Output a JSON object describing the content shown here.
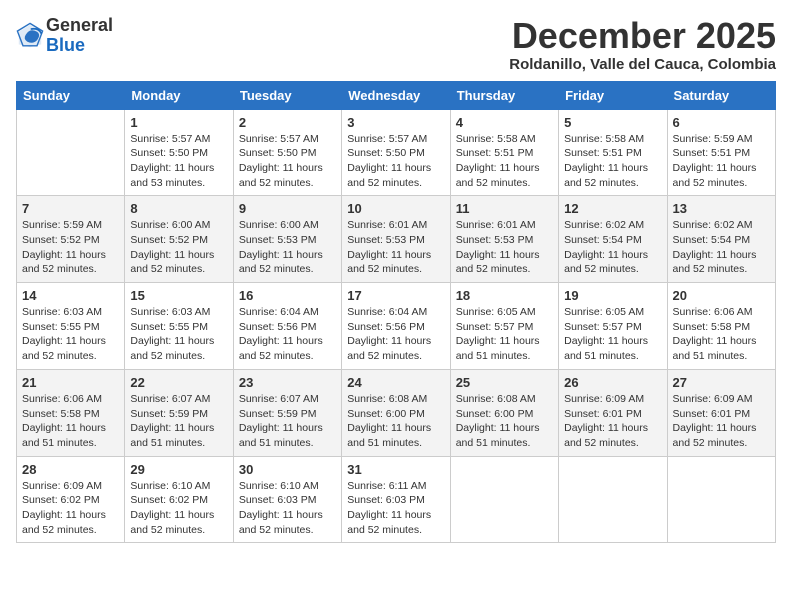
{
  "logo": {
    "general": "General",
    "blue": "Blue"
  },
  "header": {
    "month": "December 2025",
    "location": "Roldanillo, Valle del Cauca, Colombia"
  },
  "days_of_week": [
    "Sunday",
    "Monday",
    "Tuesday",
    "Wednesday",
    "Thursday",
    "Friday",
    "Saturday"
  ],
  "weeks": [
    [
      {
        "day": "",
        "sunrise": "",
        "sunset": "",
        "daylight": ""
      },
      {
        "day": "1",
        "sunrise": "Sunrise: 5:57 AM",
        "sunset": "Sunset: 5:50 PM",
        "daylight": "Daylight: 11 hours and 53 minutes."
      },
      {
        "day": "2",
        "sunrise": "Sunrise: 5:57 AM",
        "sunset": "Sunset: 5:50 PM",
        "daylight": "Daylight: 11 hours and 52 minutes."
      },
      {
        "day": "3",
        "sunrise": "Sunrise: 5:57 AM",
        "sunset": "Sunset: 5:50 PM",
        "daylight": "Daylight: 11 hours and 52 minutes."
      },
      {
        "day": "4",
        "sunrise": "Sunrise: 5:58 AM",
        "sunset": "Sunset: 5:51 PM",
        "daylight": "Daylight: 11 hours and 52 minutes."
      },
      {
        "day": "5",
        "sunrise": "Sunrise: 5:58 AM",
        "sunset": "Sunset: 5:51 PM",
        "daylight": "Daylight: 11 hours and 52 minutes."
      },
      {
        "day": "6",
        "sunrise": "Sunrise: 5:59 AM",
        "sunset": "Sunset: 5:51 PM",
        "daylight": "Daylight: 11 hours and 52 minutes."
      }
    ],
    [
      {
        "day": "7",
        "sunrise": "Sunrise: 5:59 AM",
        "sunset": "Sunset: 5:52 PM",
        "daylight": "Daylight: 11 hours and 52 minutes."
      },
      {
        "day": "8",
        "sunrise": "Sunrise: 6:00 AM",
        "sunset": "Sunset: 5:52 PM",
        "daylight": "Daylight: 11 hours and 52 minutes."
      },
      {
        "day": "9",
        "sunrise": "Sunrise: 6:00 AM",
        "sunset": "Sunset: 5:53 PM",
        "daylight": "Daylight: 11 hours and 52 minutes."
      },
      {
        "day": "10",
        "sunrise": "Sunrise: 6:01 AM",
        "sunset": "Sunset: 5:53 PM",
        "daylight": "Daylight: 11 hours and 52 minutes."
      },
      {
        "day": "11",
        "sunrise": "Sunrise: 6:01 AM",
        "sunset": "Sunset: 5:53 PM",
        "daylight": "Daylight: 11 hours and 52 minutes."
      },
      {
        "day": "12",
        "sunrise": "Sunrise: 6:02 AM",
        "sunset": "Sunset: 5:54 PM",
        "daylight": "Daylight: 11 hours and 52 minutes."
      },
      {
        "day": "13",
        "sunrise": "Sunrise: 6:02 AM",
        "sunset": "Sunset: 5:54 PM",
        "daylight": "Daylight: 11 hours and 52 minutes."
      }
    ],
    [
      {
        "day": "14",
        "sunrise": "Sunrise: 6:03 AM",
        "sunset": "Sunset: 5:55 PM",
        "daylight": "Daylight: 11 hours and 52 minutes."
      },
      {
        "day": "15",
        "sunrise": "Sunrise: 6:03 AM",
        "sunset": "Sunset: 5:55 PM",
        "daylight": "Daylight: 11 hours and 52 minutes."
      },
      {
        "day": "16",
        "sunrise": "Sunrise: 6:04 AM",
        "sunset": "Sunset: 5:56 PM",
        "daylight": "Daylight: 11 hours and 52 minutes."
      },
      {
        "day": "17",
        "sunrise": "Sunrise: 6:04 AM",
        "sunset": "Sunset: 5:56 PM",
        "daylight": "Daylight: 11 hours and 52 minutes."
      },
      {
        "day": "18",
        "sunrise": "Sunrise: 6:05 AM",
        "sunset": "Sunset: 5:57 PM",
        "daylight": "Daylight: 11 hours and 51 minutes."
      },
      {
        "day": "19",
        "sunrise": "Sunrise: 6:05 AM",
        "sunset": "Sunset: 5:57 PM",
        "daylight": "Daylight: 11 hours and 51 minutes."
      },
      {
        "day": "20",
        "sunrise": "Sunrise: 6:06 AM",
        "sunset": "Sunset: 5:58 PM",
        "daylight": "Daylight: 11 hours and 51 minutes."
      }
    ],
    [
      {
        "day": "21",
        "sunrise": "Sunrise: 6:06 AM",
        "sunset": "Sunset: 5:58 PM",
        "daylight": "Daylight: 11 hours and 51 minutes."
      },
      {
        "day": "22",
        "sunrise": "Sunrise: 6:07 AM",
        "sunset": "Sunset: 5:59 PM",
        "daylight": "Daylight: 11 hours and 51 minutes."
      },
      {
        "day": "23",
        "sunrise": "Sunrise: 6:07 AM",
        "sunset": "Sunset: 5:59 PM",
        "daylight": "Daylight: 11 hours and 51 minutes."
      },
      {
        "day": "24",
        "sunrise": "Sunrise: 6:08 AM",
        "sunset": "Sunset: 6:00 PM",
        "daylight": "Daylight: 11 hours and 51 minutes."
      },
      {
        "day": "25",
        "sunrise": "Sunrise: 6:08 AM",
        "sunset": "Sunset: 6:00 PM",
        "daylight": "Daylight: 11 hours and 51 minutes."
      },
      {
        "day": "26",
        "sunrise": "Sunrise: 6:09 AM",
        "sunset": "Sunset: 6:01 PM",
        "daylight": "Daylight: 11 hours and 52 minutes."
      },
      {
        "day": "27",
        "sunrise": "Sunrise: 6:09 AM",
        "sunset": "Sunset: 6:01 PM",
        "daylight": "Daylight: 11 hours and 52 minutes."
      }
    ],
    [
      {
        "day": "28",
        "sunrise": "Sunrise: 6:09 AM",
        "sunset": "Sunset: 6:02 PM",
        "daylight": "Daylight: 11 hours and 52 minutes."
      },
      {
        "day": "29",
        "sunrise": "Sunrise: 6:10 AM",
        "sunset": "Sunset: 6:02 PM",
        "daylight": "Daylight: 11 hours and 52 minutes."
      },
      {
        "day": "30",
        "sunrise": "Sunrise: 6:10 AM",
        "sunset": "Sunset: 6:03 PM",
        "daylight": "Daylight: 11 hours and 52 minutes."
      },
      {
        "day": "31",
        "sunrise": "Sunrise: 6:11 AM",
        "sunset": "Sunset: 6:03 PM",
        "daylight": "Daylight: 11 hours and 52 minutes."
      },
      {
        "day": "",
        "sunrise": "",
        "sunset": "",
        "daylight": ""
      },
      {
        "day": "",
        "sunrise": "",
        "sunset": "",
        "daylight": ""
      },
      {
        "day": "",
        "sunrise": "",
        "sunset": "",
        "daylight": ""
      }
    ]
  ]
}
